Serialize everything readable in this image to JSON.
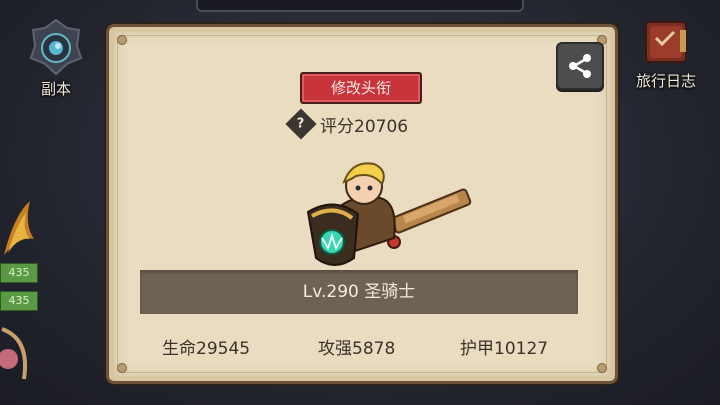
{
  "menu": {
    "dungeon_label": "副本",
    "journal_label": "旅行日志",
    "left_badges": [
      "435",
      "435"
    ]
  },
  "profile": {
    "edit_title_label": "修改头衔",
    "score_text": "评分20706",
    "level_text": "Lv.290 圣骑士",
    "stats": {
      "hp": "生命29545",
      "attack": "攻强5878",
      "armor": "护甲10127"
    }
  },
  "colors": {
    "panel_bg": "#e9dcc0",
    "title_button": "#c9343a",
    "level_bar": "#6e6252"
  },
  "icons": [
    "dungeon-icon",
    "journal-book-icon",
    "share-icon",
    "help-icon"
  ]
}
